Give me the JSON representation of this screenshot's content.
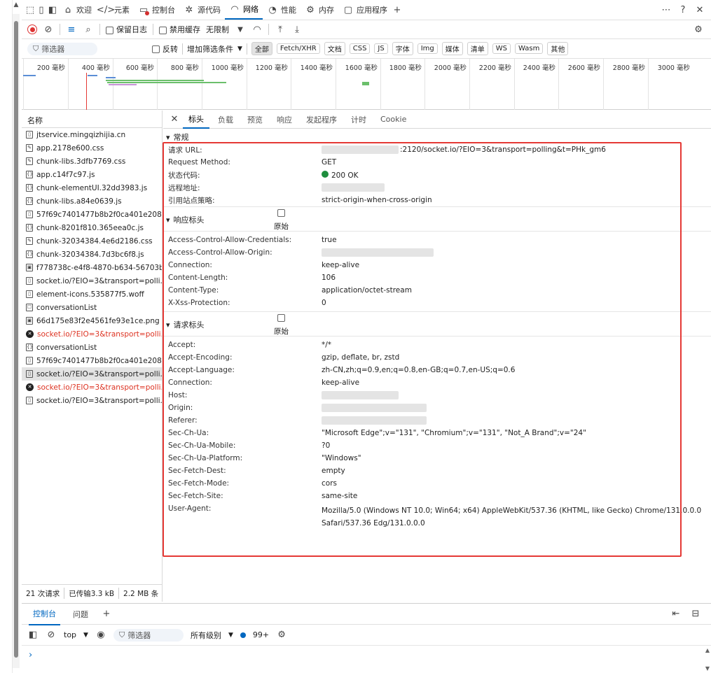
{
  "tabs": [
    {
      "label": "欢迎",
      "icon": "home-icon"
    },
    {
      "label": "元素",
      "icon": "code-icon"
    },
    {
      "label": "控制台",
      "icon": "console-icon"
    },
    {
      "label": "源代码",
      "icon": "bug-icon"
    },
    {
      "label": "网络",
      "icon": "wifi-icon",
      "active": true
    },
    {
      "label": "性能",
      "icon": "gauge-icon"
    },
    {
      "label": "内存",
      "icon": "chip-icon"
    },
    {
      "label": "应用程序",
      "icon": "app-icon"
    }
  ],
  "toolbar": {
    "preserve_log": "保留日志",
    "disable_cache": "禁用缓存",
    "throttle": "无限制"
  },
  "filter": {
    "placeholder": "筛选器",
    "invert": "反转",
    "more_filters": "增加筛选条件",
    "types": [
      "全部",
      "Fetch/XHR",
      "文档",
      "CSS",
      "JS",
      "字体",
      "Img",
      "媒体",
      "清单",
      "WS",
      "Wasm",
      "其他"
    ]
  },
  "timeline": {
    "ticks": [
      "200 毫秒",
      "400 毫秒",
      "600 毫秒",
      "800 毫秒",
      "1000 毫秒",
      "1200 毫秒",
      "1400 毫秒",
      "1600 毫秒",
      "1800 毫秒",
      "2000 毫秒",
      "2200 毫秒",
      "2400 毫秒",
      "2600 毫秒",
      "2800 毫秒",
      "3000 毫秒"
    ]
  },
  "requests": {
    "header": "名称",
    "items": [
      {
        "name": "jtservice.mingqizhijia.cn",
        "type": "doc"
      },
      {
        "name": "app.2178e600.css",
        "type": "css"
      },
      {
        "name": "chunk-libs.3dfb7769.css",
        "type": "css"
      },
      {
        "name": "app.c14f7c97.js",
        "type": "js"
      },
      {
        "name": "chunk-elementUI.32dd3983.js",
        "type": "js"
      },
      {
        "name": "chunk-libs.a84e0639.js",
        "type": "js"
      },
      {
        "name": "57f69c7401477b8b2f0ca401e2082...",
        "type": "doc"
      },
      {
        "name": "chunk-8201f810.365eea0c.js",
        "type": "js"
      },
      {
        "name": "chunk-32034384.4e6d2186.css",
        "type": "css"
      },
      {
        "name": "chunk-32034384.7d3bc6f8.js",
        "type": "js"
      },
      {
        "name": "f778738c-e4f8-4870-b634-56703b...",
        "type": "img"
      },
      {
        "name": "socket.io/?EIO=3&transport=polli...",
        "type": "doc"
      },
      {
        "name": "element-icons.535877f5.woff",
        "type": "doc"
      },
      {
        "name": "conversationList",
        "type": "xhr"
      },
      {
        "name": "66d175e83f2e4561fe93e1ce.png",
        "type": "img"
      },
      {
        "name": "socket.io/?EIO=3&transport=polli...",
        "type": "err"
      },
      {
        "name": "conversationList",
        "type": "js"
      },
      {
        "name": "57f69c7401477b8b2f0ca401e2082...",
        "type": "doc"
      },
      {
        "name": "socket.io/?EIO=3&transport=polli...",
        "type": "doc",
        "selected": true
      },
      {
        "name": "socket.io/?EIO=3&transport=polli...",
        "type": "err"
      },
      {
        "name": "socket.io/?EIO=3&transport=polli...",
        "type": "doc"
      }
    ]
  },
  "status": {
    "requests": "21 次请求",
    "transferred": "已传输3.3 kB",
    "resources": "2.2 MB 条"
  },
  "detail": {
    "tabs": [
      "标头",
      "负载",
      "预览",
      "响应",
      "发起程序",
      "计时",
      "Cookie"
    ],
    "general": {
      "title": "常规",
      "rows": [
        {
          "k": "请求 URL:",
          "v": ":2120/socket.io/?EIO=3&transport=polling&t=PHk_gm6"
        },
        {
          "k": "Request Method:",
          "v": "GET"
        },
        {
          "k": "状态代码:",
          "v": "200 OK"
        },
        {
          "k": "远程地址:",
          "v": ""
        },
        {
          "k": "引用站点策略:",
          "v": "strict-origin-when-cross-origin"
        }
      ]
    },
    "raw_label": "原始",
    "response": {
      "title": "响应标头",
      "rows": [
        {
          "k": "Access-Control-Allow-Credentials:",
          "v": "true"
        },
        {
          "k": "Access-Control-Allow-Origin:",
          "v": ""
        },
        {
          "k": "Connection:",
          "v": "keep-alive"
        },
        {
          "k": "Content-Length:",
          "v": "106"
        },
        {
          "k": "Content-Type:",
          "v": "application/octet-stream"
        },
        {
          "k": "X-Xss-Protection:",
          "v": "0"
        }
      ]
    },
    "request": {
      "title": "请求标头",
      "rows": [
        {
          "k": "Accept:",
          "v": "*/*"
        },
        {
          "k": "Accept-Encoding:",
          "v": "gzip, deflate, br, zstd"
        },
        {
          "k": "Accept-Language:",
          "v": "zh-CN,zh;q=0.9,en;q=0.8,en-GB;q=0.7,en-US;q=0.6"
        },
        {
          "k": "Connection:",
          "v": "keep-alive"
        },
        {
          "k": "Host:",
          "v": ""
        },
        {
          "k": "Origin:",
          "v": ""
        },
        {
          "k": "Referer:",
          "v": ""
        },
        {
          "k": "Sec-Ch-Ua:",
          "v": "\"Microsoft Edge\";v=\"131\", \"Chromium\";v=\"131\", \"Not_A Brand\";v=\"24\""
        },
        {
          "k": "Sec-Ch-Ua-Mobile:",
          "v": "?0"
        },
        {
          "k": "Sec-Ch-Ua-Platform:",
          "v": "\"Windows\""
        },
        {
          "k": "Sec-Fetch-Dest:",
          "v": "empty"
        },
        {
          "k": "Sec-Fetch-Mode:",
          "v": "cors"
        },
        {
          "k": "Sec-Fetch-Site:",
          "v": "same-site"
        },
        {
          "k": "User-Agent:",
          "v": "Mozilla/5.0 (Windows NT 10.0; Win64; x64) AppleWebKit/537.36 (KHTML, like Gecko) Chrome/131.0.0.0",
          "v2": "Safari/537.36 Edg/131.0.0.0"
        }
      ]
    }
  },
  "drawer": {
    "tabs": [
      "控制台",
      "问题"
    ],
    "context": "top",
    "filter": "筛选器",
    "levels": "所有级别",
    "issues": "99+"
  },
  "colors": {
    "accent": "#0067c0",
    "error": "#d32f2f",
    "highlight": "#e53935",
    "ok": "#1e8e3e"
  }
}
